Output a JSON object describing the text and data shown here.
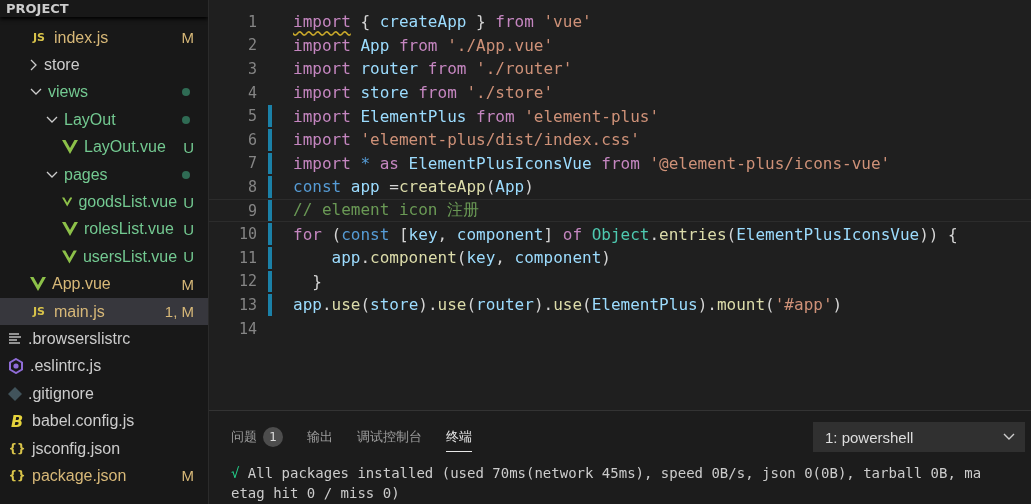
{
  "sidebar": {
    "header": "PROJECT",
    "src_items": [
      {
        "name": "index.js",
        "kind": "js",
        "icon_label": "JS",
        "color": "#d7b878",
        "status": "M",
        "selected": false
      },
      {
        "name": "store",
        "kind": "folder",
        "expanded": false,
        "color": "#cccccc",
        "selected": false
      },
      {
        "name": "views",
        "kind": "folder",
        "expanded": true,
        "color": "#73c991",
        "selected": false,
        "children": [
          {
            "name": "LayOut",
            "kind": "folder",
            "expanded": true,
            "color": "#73c991",
            "selected": false,
            "children": [
              {
                "name": "LayOut.vue",
                "kind": "vue",
                "color": "#73c991",
                "status": "U",
                "selected": false
              }
            ]
          },
          {
            "name": "pages",
            "kind": "folder",
            "expanded": true,
            "color": "#73c991",
            "selected": false,
            "children": [
              {
                "name": "goodsList.vue",
                "kind": "vue",
                "color": "#73c991",
                "status": "U",
                "selected": false
              },
              {
                "name": "rolesList.vue",
                "kind": "vue",
                "color": "#73c991",
                "status": "U",
                "selected": false
              },
              {
                "name": "usersList.vue",
                "kind": "vue",
                "color": "#73c991",
                "status": "U",
                "selected": false
              }
            ]
          }
        ]
      },
      {
        "name": "App.vue",
        "kind": "vue",
        "color": "#d7b878",
        "status": "M",
        "selected": false
      },
      {
        "name": "main.js",
        "kind": "js",
        "icon_label": "JS",
        "color": "#d7b878",
        "status": "1, M",
        "selected": true
      }
    ],
    "root_items": [
      {
        "name": ".browserslistrc",
        "kind": "lines",
        "color": "#cccccc",
        "selected": false
      },
      {
        "name": ".eslintrc.js",
        "kind": "eslint",
        "color": "#cccccc",
        "selected": false
      },
      {
        "name": ".gitignore",
        "kind": "git",
        "color": "#cccccc",
        "selected": false
      },
      {
        "name": "babel.config.js",
        "kind": "babel",
        "icon_label": "B",
        "color": "#cccccc",
        "selected": false
      },
      {
        "name": "jsconfig.json",
        "kind": "json",
        "icon_label": "{}",
        "color": "#cccccc",
        "selected": false
      },
      {
        "name": "package.json",
        "kind": "json",
        "icon_label": "{}",
        "color": "#d7b878",
        "status": "M",
        "selected": false
      }
    ]
  },
  "editor": {
    "lines": [
      {
        "number": "1",
        "changed": false,
        "current": false,
        "tokens": [
          {
            "kind": "kw",
            "text": "import",
            "warning": true
          },
          {
            "kind": "plain",
            "text": " { "
          },
          {
            "kind": "var",
            "text": "createApp"
          },
          {
            "kind": "plain",
            "text": " } "
          },
          {
            "kind": "kw",
            "text": "from"
          },
          {
            "kind": "str",
            "text": " 'vue'"
          }
        ]
      },
      {
        "number": "2",
        "changed": false,
        "current": false,
        "tokens": [
          {
            "kind": "kw",
            "text": "import"
          },
          {
            "kind": "var",
            "text": " App"
          },
          {
            "kind": "kw",
            "text": " from"
          },
          {
            "kind": "str",
            "text": " './App.vue'"
          }
        ]
      },
      {
        "number": "3",
        "changed": false,
        "current": false,
        "tokens": [
          {
            "kind": "kw",
            "text": "import"
          },
          {
            "kind": "var",
            "text": " router"
          },
          {
            "kind": "kw",
            "text": " from"
          },
          {
            "kind": "str",
            "text": " './router'"
          }
        ]
      },
      {
        "number": "4",
        "changed": false,
        "current": false,
        "tokens": [
          {
            "kind": "kw",
            "text": "import"
          },
          {
            "kind": "var",
            "text": " store"
          },
          {
            "kind": "kw",
            "text": " from"
          },
          {
            "kind": "str",
            "text": " './store'"
          }
        ]
      },
      {
        "number": "5",
        "changed": true,
        "current": false,
        "tokens": [
          {
            "kind": "kw",
            "text": "import"
          },
          {
            "kind": "var",
            "text": " ElementPlus"
          },
          {
            "kind": "kw",
            "text": " from"
          },
          {
            "kind": "str",
            "text": " 'element-plus'"
          }
        ]
      },
      {
        "number": "6",
        "changed": true,
        "current": false,
        "tokens": [
          {
            "kind": "kw",
            "text": "import"
          },
          {
            "kind": "str",
            "text": " 'element-plus/dist/index.css'"
          }
        ]
      },
      {
        "number": "7",
        "changed": true,
        "current": false,
        "tokens": [
          {
            "kind": "kw",
            "text": "import"
          },
          {
            "kind": "const",
            "text": " *"
          },
          {
            "kind": "kw",
            "text": " as"
          },
          {
            "kind": "var",
            "text": " ElementPlusIconsVue"
          },
          {
            "kind": "kw",
            "text": " from"
          },
          {
            "kind": "str",
            "text": " '@element-plus/icons-vue'"
          }
        ]
      },
      {
        "number": "8",
        "changed": true,
        "current": false,
        "tokens": [
          {
            "kind": "const",
            "text": "const"
          },
          {
            "kind": "var",
            "text": " app"
          },
          {
            "kind": "plain",
            "text": " ="
          },
          {
            "kind": "func",
            "text": "createApp"
          },
          {
            "kind": "plain",
            "text": "("
          },
          {
            "kind": "var",
            "text": "App"
          },
          {
            "kind": "plain",
            "text": ")"
          }
        ]
      },
      {
        "number": "9",
        "changed": true,
        "current": true,
        "tokens": [
          {
            "kind": "comment",
            "text": "// element icon 注册"
          }
        ]
      },
      {
        "number": "10",
        "changed": true,
        "current": false,
        "tokens": [
          {
            "kind": "kw",
            "text": "for"
          },
          {
            "kind": "plain",
            "text": " ("
          },
          {
            "kind": "const",
            "text": "const"
          },
          {
            "kind": "plain",
            "text": " ["
          },
          {
            "kind": "var",
            "text": "key"
          },
          {
            "kind": "plain",
            "text": ", "
          },
          {
            "kind": "var",
            "text": "component"
          },
          {
            "kind": "plain",
            "text": "] "
          },
          {
            "kind": "kw",
            "text": "of"
          },
          {
            "kind": "class",
            "text": " Object"
          },
          {
            "kind": "plain",
            "text": "."
          },
          {
            "kind": "func",
            "text": "entries"
          },
          {
            "kind": "plain",
            "text": "("
          },
          {
            "kind": "var",
            "text": "ElementPlusIconsVue"
          },
          {
            "kind": "plain",
            "text": ")) {"
          }
        ]
      },
      {
        "number": "11",
        "changed": true,
        "current": false,
        "tokens": [
          {
            "kind": "var",
            "text": "    app"
          },
          {
            "kind": "plain",
            "text": "."
          },
          {
            "kind": "func",
            "text": "component"
          },
          {
            "kind": "plain",
            "text": "("
          },
          {
            "kind": "var",
            "text": "key"
          },
          {
            "kind": "plain",
            "text": ", "
          },
          {
            "kind": "var",
            "text": "component"
          },
          {
            "kind": "plain",
            "text": ")"
          }
        ]
      },
      {
        "number": "12",
        "changed": true,
        "current": false,
        "tokens": [
          {
            "kind": "plain",
            "text": "  }"
          }
        ]
      },
      {
        "number": "13",
        "changed": true,
        "current": false,
        "tokens": [
          {
            "kind": "var",
            "text": "app"
          },
          {
            "kind": "plain",
            "text": "."
          },
          {
            "kind": "func",
            "text": "use"
          },
          {
            "kind": "plain",
            "text": "("
          },
          {
            "kind": "var",
            "text": "store"
          },
          {
            "kind": "plain",
            "text": ")."
          },
          {
            "kind": "func",
            "text": "use"
          },
          {
            "kind": "plain",
            "text": "("
          },
          {
            "kind": "var",
            "text": "router"
          },
          {
            "kind": "plain",
            "text": ")."
          },
          {
            "kind": "func",
            "text": "use"
          },
          {
            "kind": "plain",
            "text": "("
          },
          {
            "kind": "var",
            "text": "ElementPlus"
          },
          {
            "kind": "plain",
            "text": ")."
          },
          {
            "kind": "func",
            "text": "mount"
          },
          {
            "kind": "plain",
            "text": "("
          },
          {
            "kind": "str",
            "text": "'#app'"
          },
          {
            "kind": "plain",
            "text": ")"
          }
        ]
      },
      {
        "number": "14",
        "changed": false,
        "current": false
      }
    ]
  },
  "panel": {
    "tabs": [
      {
        "label": "问题",
        "badge": "1",
        "selected": false
      },
      {
        "label": "输出",
        "selected": false
      },
      {
        "label": "调试控制台",
        "selected": false
      },
      {
        "label": "终端",
        "selected": true
      }
    ],
    "terminal_select": "1: powershell",
    "terminal_lines": [
      {
        "mark": "√",
        "text": " All packages installed (used 70ms(network 45ms), speed 0B/s, json 0(0B), tarball 0B, ma"
      },
      {
        "text": "etag hit 0 / miss 0)"
      }
    ]
  }
}
